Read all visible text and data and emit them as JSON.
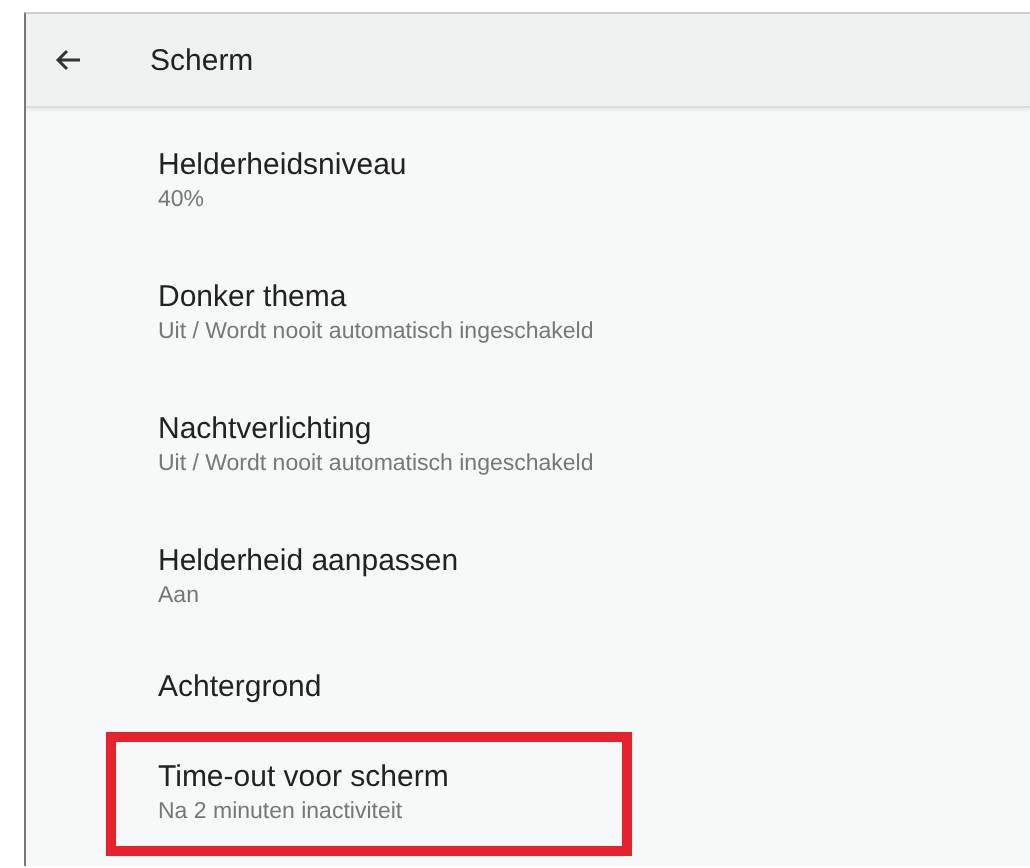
{
  "header": {
    "title": "Scherm"
  },
  "items": [
    {
      "title": "Helderheidsniveau",
      "summary": "40%",
      "highlighted": false
    },
    {
      "title": "Donker thema",
      "summary": "Uit / Wordt nooit automatisch ingeschakeld",
      "highlighted": false
    },
    {
      "title": "Nachtverlichting",
      "summary": "Uit / Wordt nooit automatisch ingeschakeld",
      "highlighted": false
    },
    {
      "title": "Helderheid aanpassen",
      "summary": "Aan",
      "highlighted": false
    },
    {
      "title": "Achtergrond",
      "highlighted": false
    },
    {
      "title": "Time-out voor scherm",
      "summary": "Na 2 minuten inactiviteit",
      "highlighted": true
    }
  ]
}
